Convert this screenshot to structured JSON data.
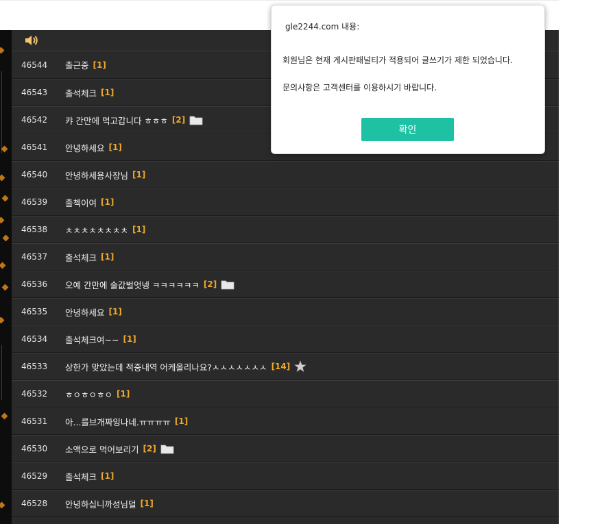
{
  "dialog": {
    "origin": "gle2244.com 내용:",
    "message_line1": "회원님은 현재 게시판패널티가 적용되어 글쓰기가 제한 되었습니다.",
    "message_line2": "문의사항은 고객센터를 이용하시기 바랍니다.",
    "ok_label": "확인",
    "ok_color": "#1ec1a3"
  },
  "board": {
    "accent_color": "#f0a82a",
    "rows": [
      {
        "num": "46544",
        "title": "출근중",
        "count": "[1]",
        "icon": ""
      },
      {
        "num": "46543",
        "title": "출석체크",
        "count": "[1]",
        "icon": ""
      },
      {
        "num": "46542",
        "title": "캬 간만에 먹고갑니다 ㅎㅎㅎ",
        "count": "[2]",
        "icon": "folder-icon"
      },
      {
        "num": "46541",
        "title": "안녕하세요",
        "count": "[1]",
        "icon": ""
      },
      {
        "num": "46540",
        "title": "안녕하세용사장님",
        "count": "[1]",
        "icon": ""
      },
      {
        "num": "46539",
        "title": "출첵이여",
        "count": "[1]",
        "icon": ""
      },
      {
        "num": "46538",
        "title": "ㅊㅊㅊㅊㅊㅊㅊㅊ",
        "count": "[1]",
        "icon": ""
      },
      {
        "num": "46537",
        "title": "출석체크",
        "count": "[1]",
        "icon": ""
      },
      {
        "num": "46536",
        "title": "오예 간만에 술값벌엇넹 ㅋㅋㅋㅋㅋㅋ",
        "count": "[2]",
        "icon": "folder-icon"
      },
      {
        "num": "46535",
        "title": "안녕하세요",
        "count": "[1]",
        "icon": ""
      },
      {
        "num": "46534",
        "title": "출석체크여~~",
        "count": "[1]",
        "icon": ""
      },
      {
        "num": "46533",
        "title": "상한가 맞았는데 적중내역 어케올리나요?ㅅㅅㅅㅅㅅㅅㅅ",
        "count": "[14]",
        "icon": "star-icon"
      },
      {
        "num": "46532",
        "title": "ㅎㅇㅎㅇㅎㅇ",
        "count": "[1]",
        "icon": ""
      },
      {
        "num": "46531",
        "title": "아...를브개짜잉나네.ㅠㅠㅠㅠ",
        "count": "[1]",
        "icon": ""
      },
      {
        "num": "46530",
        "title": "소액으로 먹어보리기",
        "count": "[2]",
        "icon": "folder-icon"
      },
      {
        "num": "46529",
        "title": "출석체크",
        "count": "[1]",
        "icon": ""
      },
      {
        "num": "46528",
        "title": "안녕하십니까성님덜",
        "count": "[1]",
        "icon": ""
      }
    ]
  }
}
